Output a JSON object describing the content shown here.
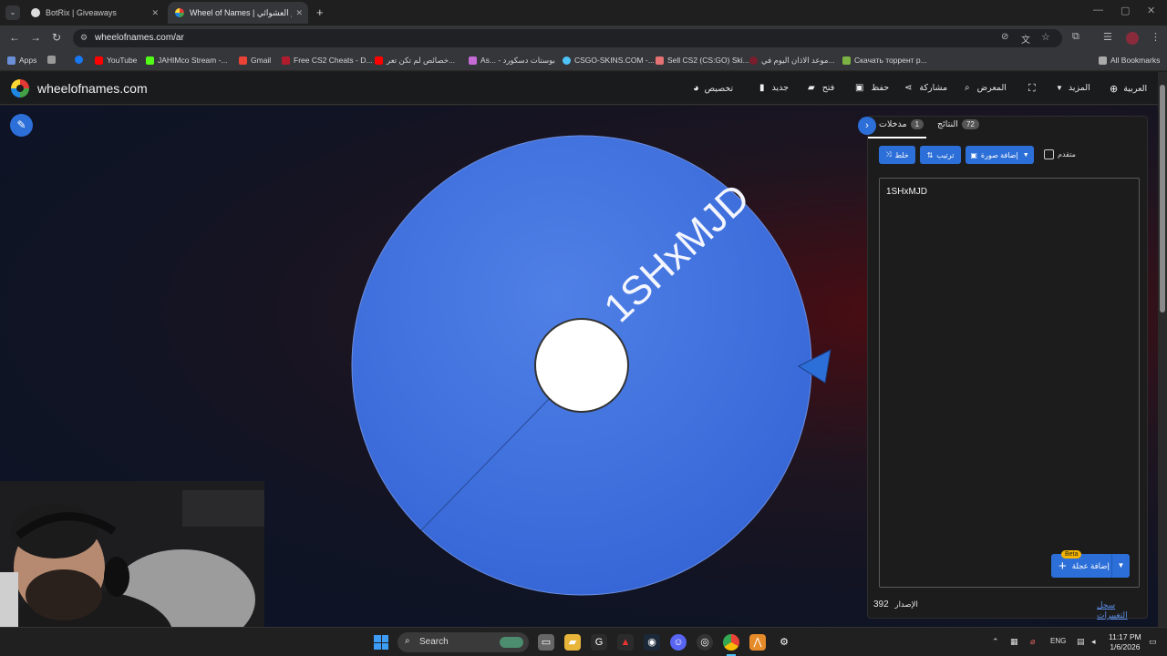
{
  "browser": {
    "tabs": [
      {
        "title": "BotRix | Giveaways",
        "active": false
      },
      {
        "title": "Wheel of Names | اسم العشوائي",
        "active": true
      }
    ],
    "url": "wheelofnames.com/ar",
    "bookmarks": [
      "Apps",
      "YouTube",
      "JAHIMco Stream -...",
      "Gmail",
      "Free CS2 Cheats - D...",
      "خصائص لم تكن تعر...",
      "As... - بوستات دسكورد",
      "CSGO-SKINS.COM -...",
      "Sell CS2 (CS:GO) Ski...",
      "موعد الاذان اليوم في...",
      "Скачать торрент р..."
    ],
    "all_bookmarks": "All Bookmarks"
  },
  "site": {
    "name": "wheelofnames.com",
    "menu": {
      "customize": "تخصيص",
      "new": "جديد",
      "open": "فتح",
      "save": "حفظ",
      "share": "مشاركة",
      "gallery": "المعرض",
      "more": "المزيد",
      "language": "العربية"
    }
  },
  "wheel": {
    "entries": [
      "1SHxMJD"
    ],
    "color": "#3e6fdc",
    "pointer_color": "#2d6fd8"
  },
  "panel": {
    "tab_entries_label": "مدخلات",
    "tab_entries_count": "1",
    "tab_results_label": "النتائج",
    "tab_results_count": "72",
    "shuffle_label": "خلط",
    "sort_label": "ترتيب",
    "add_image_label": "إضافة صورة",
    "advanced_label": "متقدم",
    "entries_text": "1SHxMJD",
    "add_wheel_label": "إضافة عجلة",
    "beta_label": "Beta",
    "version_label": "الإصدار",
    "version_number": "392",
    "changelog_label": "سجل التغييرات"
  },
  "taskbar": {
    "search_label": "Search",
    "language": "ENG",
    "time": "11:17 PM",
    "date": "1/6/2026"
  }
}
